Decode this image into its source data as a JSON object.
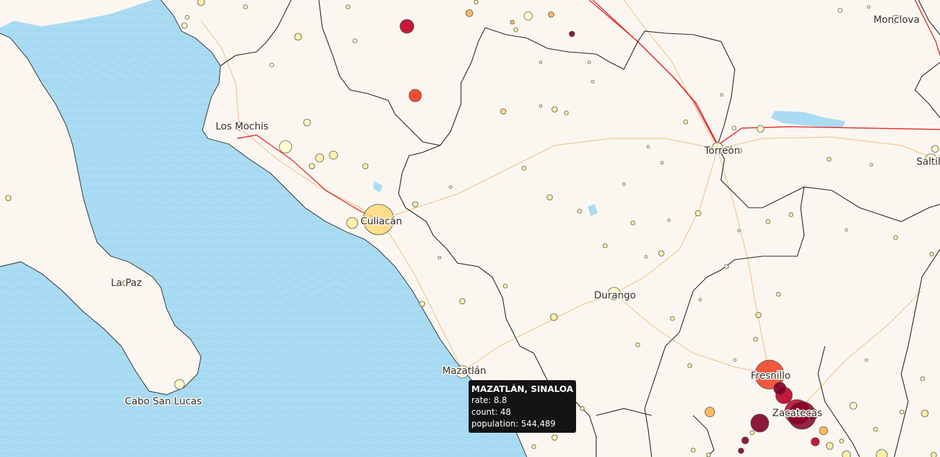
{
  "map": {
    "colors": {
      "land": "#fbf7f0",
      "water": "#a9dbf3",
      "state_border": "#222222",
      "highway": "#f2c89a",
      "rail": "#e03030",
      "dot_stroke": "#555555"
    },
    "labels": [
      {
        "name": "Los Mochis"
      },
      {
        "name": "Culiacán"
      },
      {
        "name": "La Paz"
      },
      {
        "name": "Cabo San Lucas"
      },
      {
        "name": "Mazatlán"
      },
      {
        "name": "Durango"
      },
      {
        "name": "Torreón"
      },
      {
        "name": "Fresnillo"
      },
      {
        "name": "Zacatecas"
      },
      {
        "name": "Monclova"
      },
      {
        "name": "Saltillo"
      }
    ],
    "color_scale": [
      "#ffffcc",
      "#ffeda0",
      "#fed976",
      "#feb24c",
      "#fd8d3c",
      "#f03b20",
      "#bd0026",
      "#800026"
    ]
  },
  "tooltip": {
    "title": "MAZATLÁN, SINALOA",
    "rate_label": "rate:",
    "rate_value": "8.8",
    "count_label": "count:",
    "count_value": "48",
    "population_label": "population:",
    "population_value": "544,489"
  }
}
